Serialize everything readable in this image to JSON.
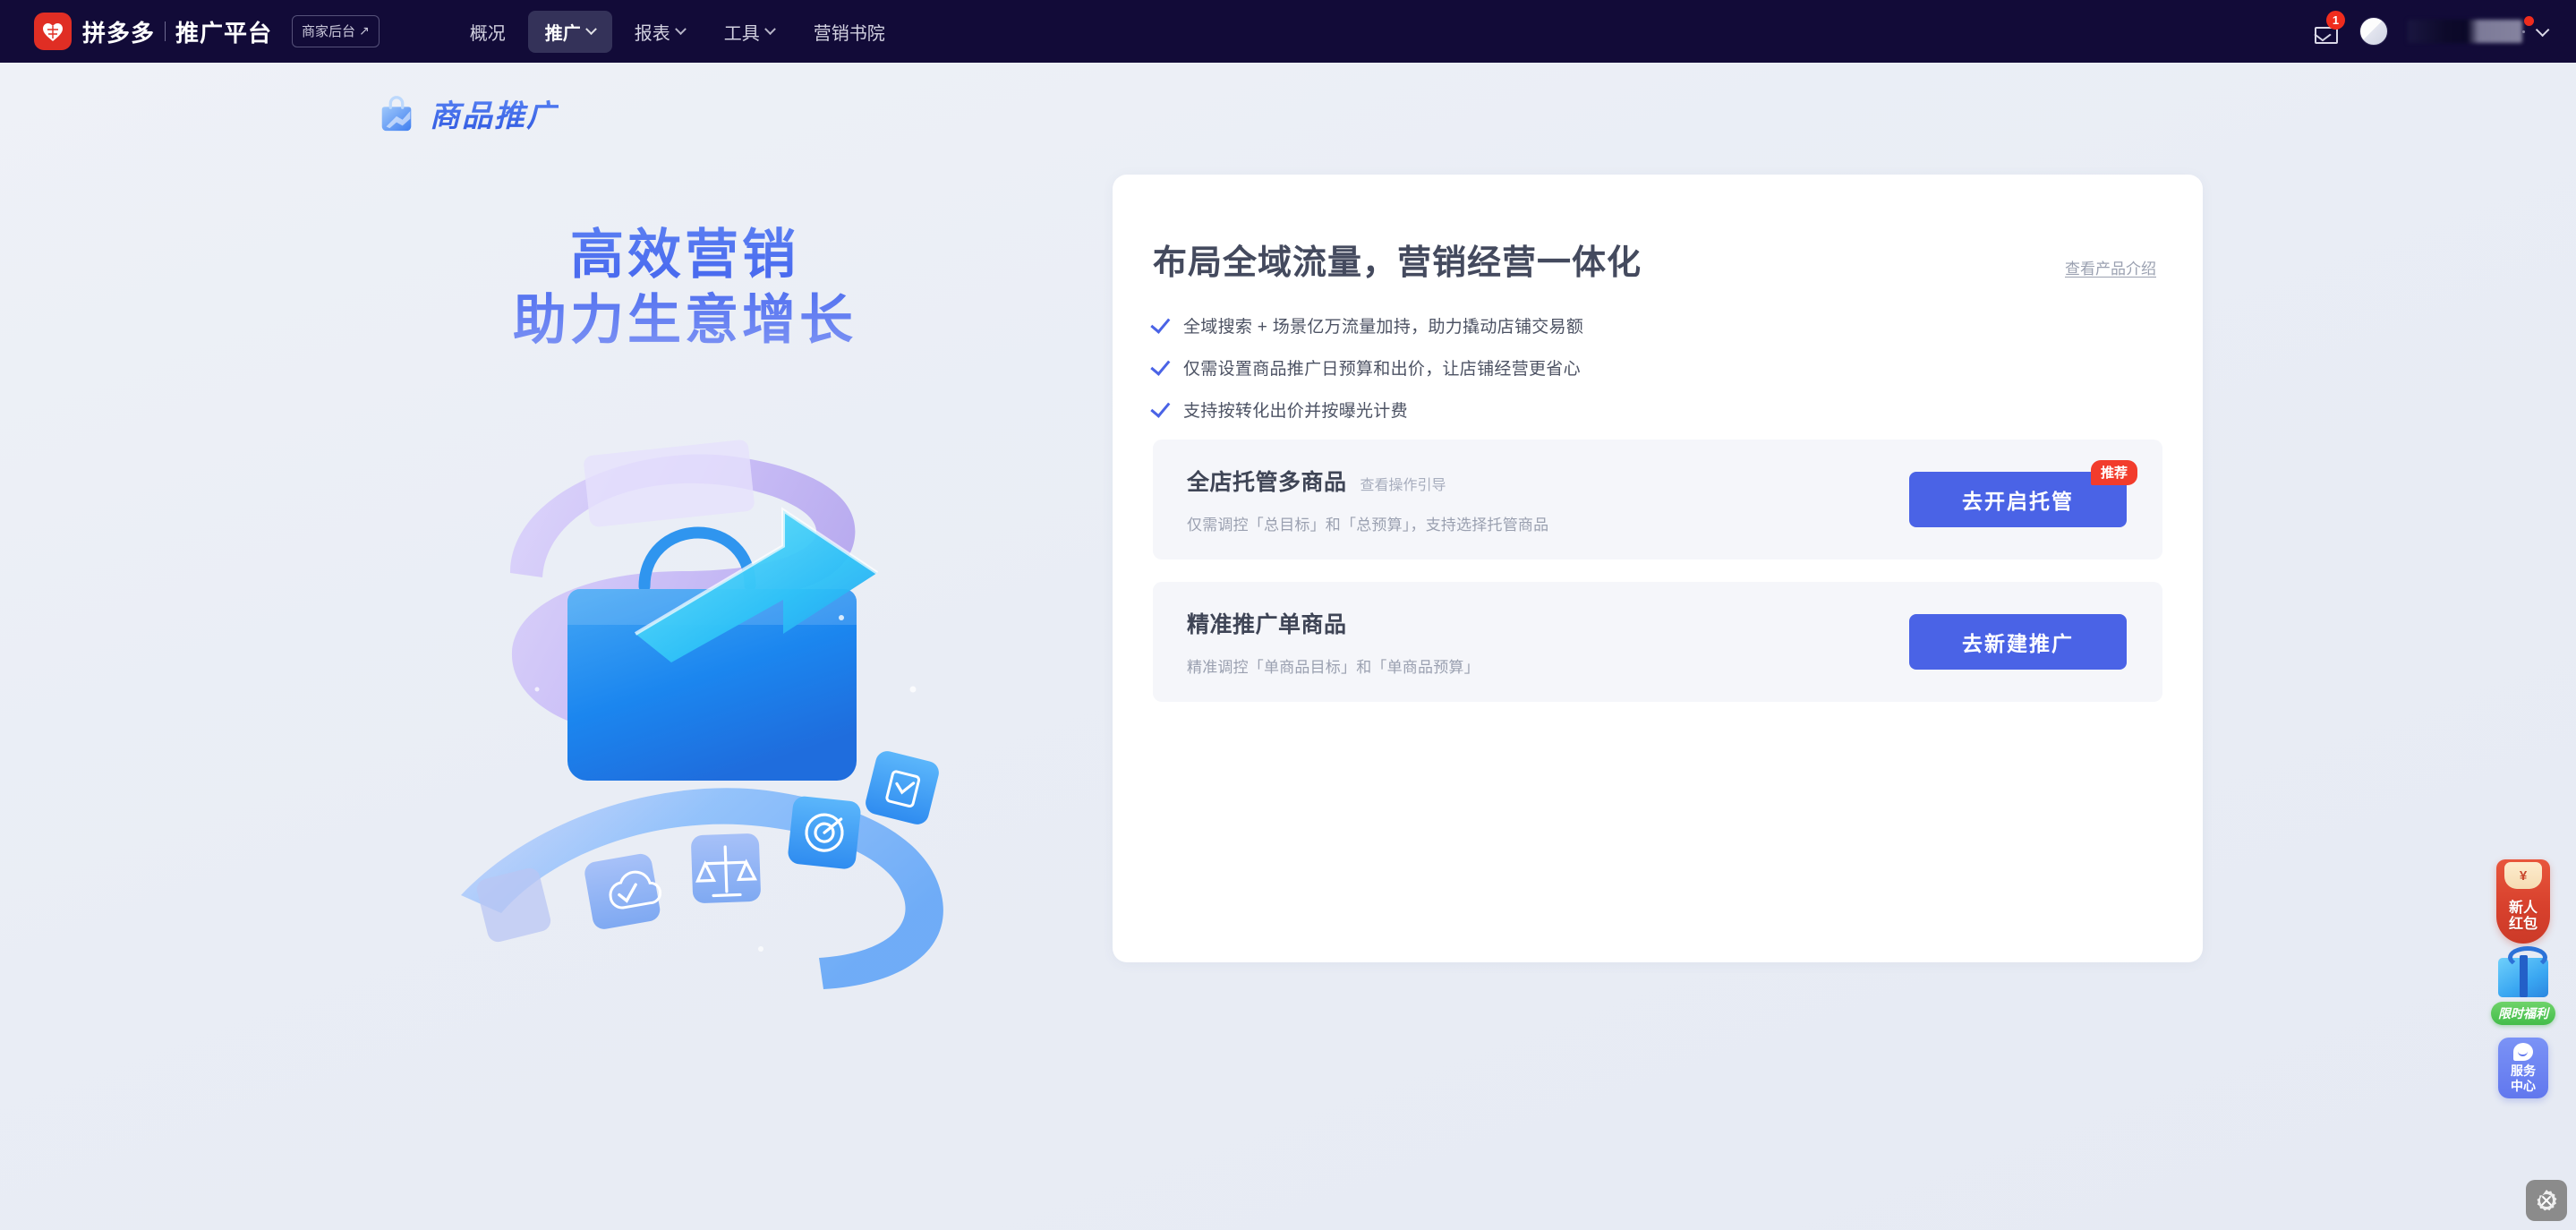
{
  "navbar": {
    "logo_icon": "pinduoduo-logo-icon",
    "brand": "拼多多",
    "platform": "推广平台",
    "merchant_button": "商家后台",
    "merchant_arrow": "↗",
    "menu": [
      {
        "label": "概况",
        "has_dropdown": false,
        "active": false
      },
      {
        "label": "推广",
        "has_dropdown": true,
        "active": true
      },
      {
        "label": "报表",
        "has_dropdown": true,
        "active": false
      },
      {
        "label": "工具",
        "has_dropdown": true,
        "active": false
      },
      {
        "label": "营销书院",
        "has_dropdown": false,
        "active": false
      }
    ],
    "mail_icon": "mail-icon",
    "mail_badge": "1",
    "avatar_icon": "avatar-icon",
    "user_menu_icon": "chevron-down-icon",
    "active_bg": "#343259",
    "bg": "#120b38"
  },
  "hero": {
    "icon": "shopping-bag-icon",
    "title": "商品推广",
    "slogan": "高效营销\n助力生意增长",
    "illustration_icon": "promotion-3d-illustration",
    "accent": "#4a63e6"
  },
  "main_card": {
    "title": "布局全域流量，营销经营一体化",
    "product_link": "查看产品介绍",
    "features": [
      "全域搜索 + 场景亿万流量加持，助力撬动店铺交易额",
      "仅需设置商品推广日预算和出价，让店铺经营更省心",
      "支持按转化出价并按曝光计费"
    ],
    "check_icon": "check-icon",
    "options": [
      {
        "title": "全店托管多商品",
        "guide_link": "查看操作引导",
        "desc": "仅需调控「总目标」和「总预算」，支持选择托管商品",
        "cta": "去开启托管",
        "badge": "推荐"
      },
      {
        "title": "精准推广单商品",
        "guide_link": "",
        "desc": "精准调控「单商品目标」和「单商品预算」",
        "cta": "去新建推广",
        "badge": ""
      }
    ],
    "cta_color": "#4a63e6",
    "badge_color": "#f23c2c",
    "subcard_bg": "#f5f6fa"
  },
  "floats": {
    "redpack": {
      "icon": "red-envelope-icon",
      "symbol": "¥",
      "label": "新人\n红包"
    },
    "gift": {
      "icon": "gift-box-icon",
      "label": "限时福利"
    },
    "service": {
      "icon": "chat-bubble-icon",
      "label": "服务\n中心"
    },
    "settings": {
      "icon": "tools-gear-icon"
    }
  }
}
